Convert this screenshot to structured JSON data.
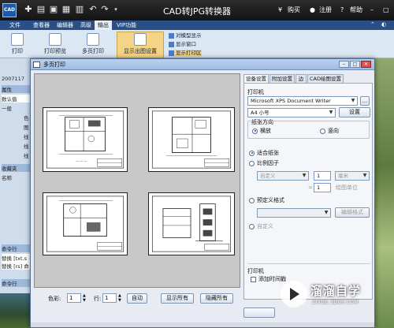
{
  "app": {
    "title": "CAD转JPG转换器",
    "icon_text": "CAD",
    "top_links": [
      "购买",
      "注册",
      "帮助"
    ]
  },
  "menu": [
    "文件",
    "查看器",
    "编辑器",
    "高级",
    "输出",
    "VIP功能"
  ],
  "menu_active_index": 4,
  "ribbon": {
    "buttons": [
      "打印",
      "打印预览",
      "多页打印",
      "显示出图设置"
    ],
    "small_buttons": [
      "对模型显示",
      "显示窗口",
      "显示打印区"
    ]
  },
  "left_panel": [
    "2007117",
    "属性",
    "数认值",
    "一般",
    "色",
    "图",
    "线",
    "线",
    "线",
    "收藏夹",
    "名称",
    "命令行",
    "替换 [txt.s",
    "替换 [rs] 命",
    "命令行"
  ],
  "dialog": {
    "title": "多页打印",
    "preview_bottom": {
      "color_label": "色彩:",
      "color_value": "1",
      "row_label": "行:",
      "row_value": "1",
      "auto_button": "自动",
      "show_all_button": "显示所有",
      "hide_all_button": "隐藏所有"
    },
    "tabs": [
      "设备设置",
      "附加设置",
      "边",
      "CAD绘图设置"
    ],
    "settings": {
      "printer_label": "打印机",
      "printer_value": "Microsoft XPS Document Writer",
      "browse_button": "...",
      "paper_value": "A4 小号",
      "setup_button": "设置",
      "orientation_label": "纸张方向",
      "landscape": "横放",
      "portrait": "竖向",
      "fit_paper": "适合纸张",
      "scale_factor": "比例因子",
      "custom_value": "自定义",
      "scale_num": "1",
      "unit_value": "毫米",
      "scale_den": "1",
      "drawing_unit": "绘图单位",
      "preset_format": "预定义格式",
      "edit_format_button": "编辑格式",
      "custom": "自定义",
      "printer_section": "打印机",
      "add_time_stamp": "添加时间戳"
    }
  },
  "watermark": {
    "title": "溜溜自学",
    "subtitle": "ZIXUE.3D66.COM"
  }
}
